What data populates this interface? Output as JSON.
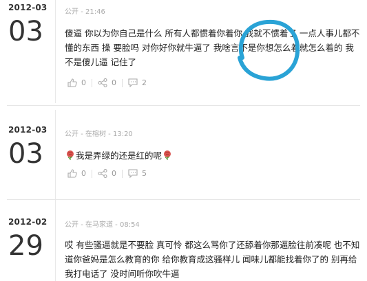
{
  "posts": [
    {
      "year_month": "2012-03",
      "day": "03",
      "visibility": "公开",
      "time": "21:46",
      "content": "傻逼 你以为你自己是什么 所有人都惯着你着你 我就不惯着了 一点人事儿都不懂的东西 操 要脸吗 对你好你就牛逼了 我啥言不是你想怎么着就怎么着的 我不是傻儿逼 记住了",
      "likes": "0",
      "shares": "0",
      "comments": "2"
    },
    {
      "year_month": "2012-03",
      "day": "03",
      "visibility": "公开",
      "location": "在榕树",
      "time": "13:20",
      "content": "我是弄绿的还是红的呢",
      "likes": "0",
      "shares": "0",
      "comments": "5"
    },
    {
      "year_month": "2012-02",
      "day": "29",
      "visibility": "公开",
      "location": "在马家道",
      "time": "08:54",
      "content": "哎 有些骚逼就是不要脸 真可怜 都这么骂你了还舔着你那逼脸往前凑呢 也不知道你爸妈是怎么教育的你 给你教育成这骚样儿 闻味儿都能找着你了的 别再给我打电话了 没时间听你吹牛逼",
      "likes": "",
      "shares": "",
      "comments": ""
    }
  ],
  "colors": {
    "annotation_circle": "#2aa3d6",
    "rose": "#d9534f"
  }
}
